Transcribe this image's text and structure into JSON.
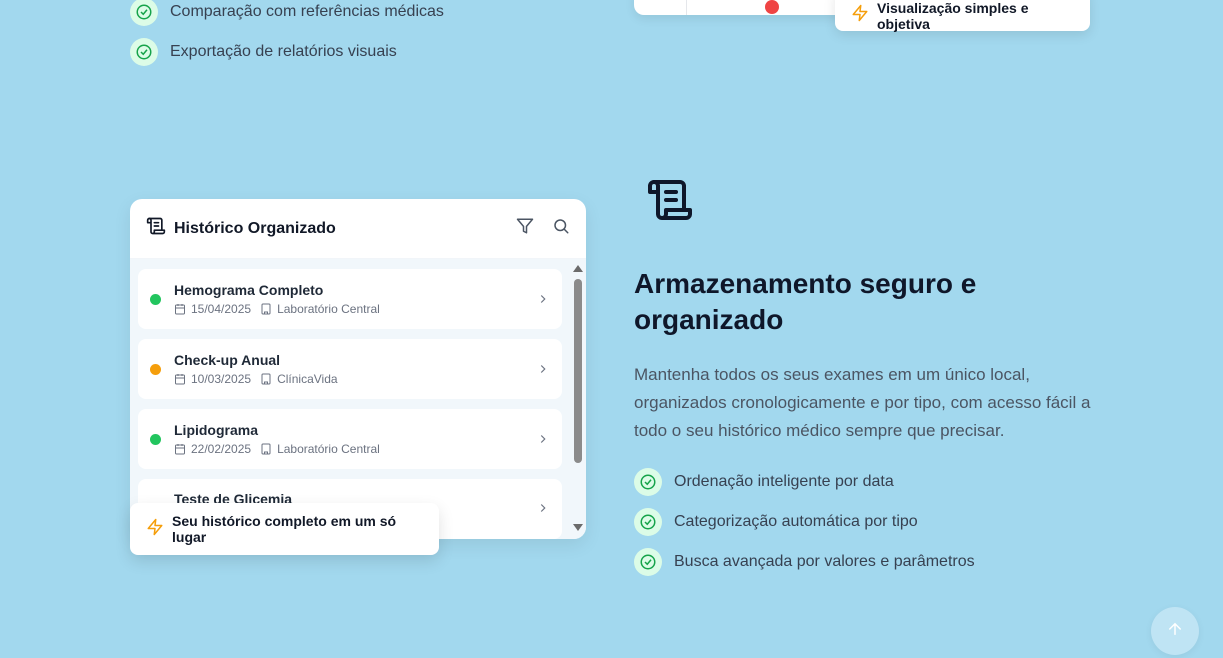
{
  "top_section": {
    "features": [
      "Comparação com referências médicas",
      "Exportação de relatórios visuais"
    ],
    "badge_text": "Visualização simples e objetiva"
  },
  "history_card": {
    "title": "Histórico Organizado",
    "items": [
      {
        "title": "Hemograma Completo",
        "date": "15/04/2025",
        "lab": "Laboratório Central",
        "status_color": "#22c55e"
      },
      {
        "title": "Check-up Anual",
        "date": "10/03/2025",
        "lab": "ClínicaVida",
        "status_color": "#f59e0b"
      },
      {
        "title": "Lipidograma",
        "date": "22/02/2025",
        "lab": "Laboratório Central",
        "status_color": "#22c55e"
      },
      {
        "title": "Teste de Glicemia"
      }
    ],
    "badge_text": "Seu histórico completo em um só lugar"
  },
  "section": {
    "heading": "Armazenamento seguro e organizado",
    "description": "Mantenha todos os seus exames em um único local, organizados cronologicamente e por tipo, com acesso fácil a todo o seu histórico médico sempre que precisar.",
    "features": [
      "Ordenação inteligente por data",
      "Categorização automática por tipo",
      "Busca avançada por valores e parâmetros"
    ]
  },
  "colors": {
    "background": "#a2d8ee",
    "check_green": "#16a34a",
    "accent_orange": "#f59e0b"
  },
  "icons": [
    "check-circle-icon",
    "zap-icon",
    "scroll-icon",
    "filter-icon",
    "search-icon",
    "calendar-icon",
    "building-icon",
    "chevron-right-icon",
    "arrow-up-icon"
  ]
}
